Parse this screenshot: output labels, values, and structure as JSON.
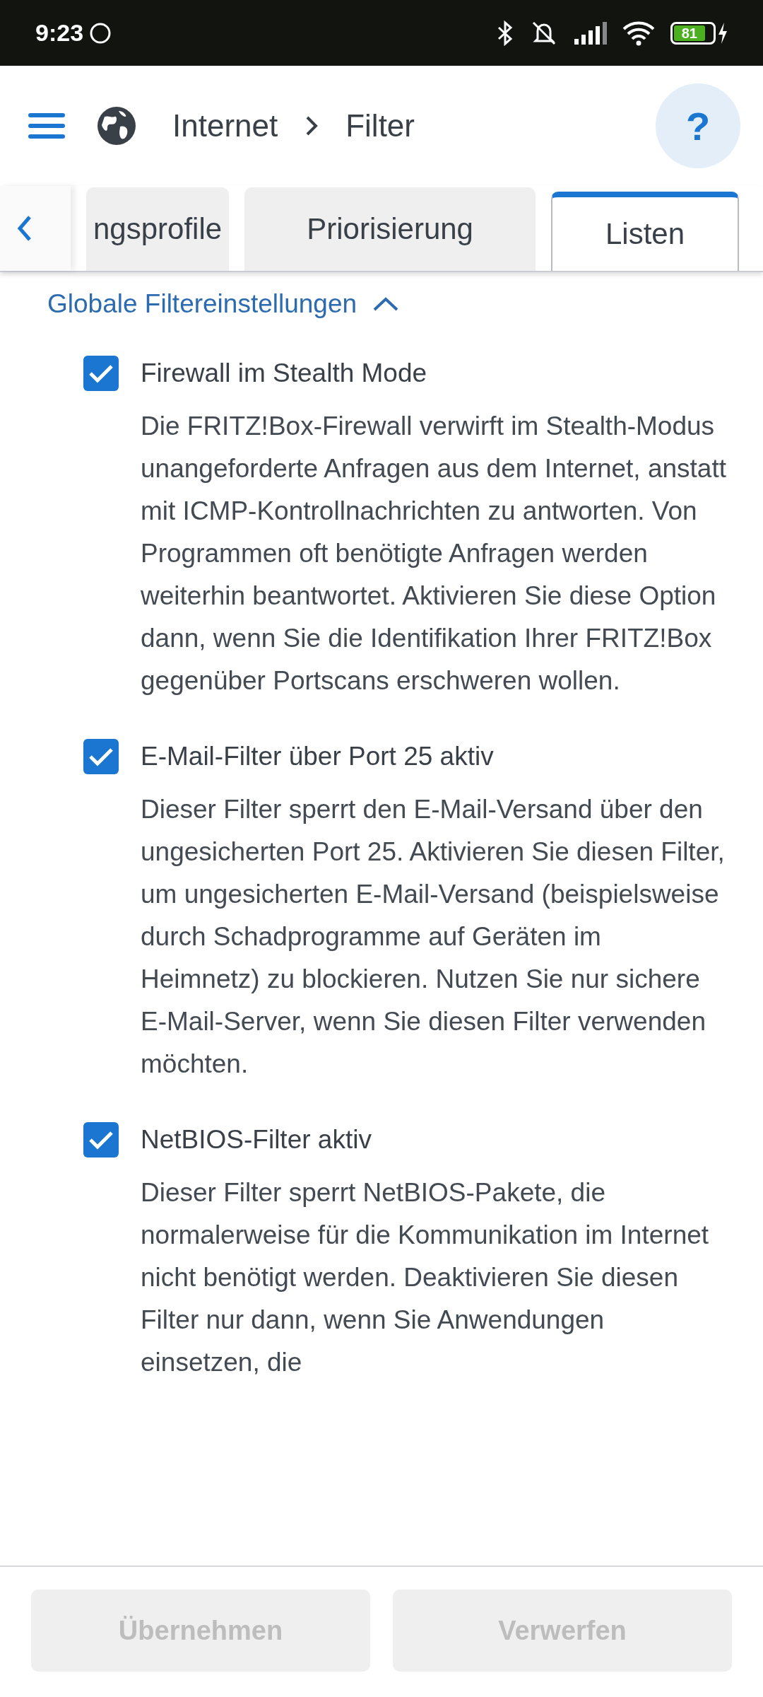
{
  "status_bar": {
    "time": "9:23",
    "battery": "81"
  },
  "header": {
    "breadcrumb": [
      "Internet",
      "Filter"
    ],
    "help": "?"
  },
  "tabs": [
    {
      "label": "ngsprofile",
      "selected": false
    },
    {
      "label": "Priorisierung",
      "selected": false
    },
    {
      "label": "Listen",
      "selected": true
    }
  ],
  "section": {
    "title": "Globale Filtereinstellungen",
    "expanded": true
  },
  "options": [
    {
      "label": "Firewall im Stealth Mode",
      "checked": true,
      "description": "Die FRITZ!Box-Firewall verwirft im Stealth-Modus unangeforderte Anfragen aus dem Internet, anstatt mit ICMP-Kontrollnachrichten zu antworten. Von Programmen oft benötigte Anfragen werden weiterhin beantwortet. Aktivieren Sie diese Option dann, wenn Sie die Identifikation Ihrer FRITZ!Box gegenüber Portscans erschweren wollen."
    },
    {
      "label": "E-Mail-Filter über Port 25 aktiv",
      "checked": true,
      "description": "Dieser Filter sperrt den E-Mail-Versand über den ungesicherten Port 25. Aktivieren Sie diesen Filter, um ungesicherten E-Mail-Versand (beispielsweise durch Schadprogramme auf Geräten im Heimnetz) zu blockieren. Nutzen Sie nur sichere E-Mail-Server, wenn Sie diesen Filter verwenden möchten."
    },
    {
      "label": "NetBIOS-Filter aktiv",
      "checked": true,
      "description": "Dieser Filter sperrt NetBIOS-Pakete, die normalerweise für die Kommunikation im Internet nicht benötigt werden. Deaktivieren Sie diesen Filter nur dann, wenn Sie Anwendungen einsetzen, die"
    }
  ],
  "buttons": [
    {
      "label": "Übernehmen",
      "disabled": true
    },
    {
      "label": "Verwerfen",
      "disabled": true
    }
  ]
}
